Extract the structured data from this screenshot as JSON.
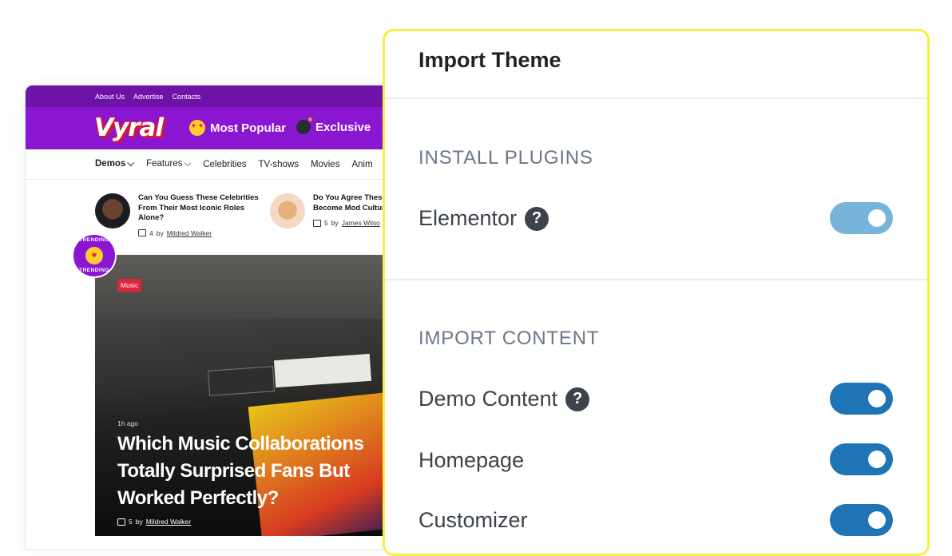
{
  "site": {
    "top_links": [
      "About Us",
      "Advertise",
      "Contacts"
    ],
    "logo": "Vyral",
    "header_links": [
      {
        "label": "Most Popular",
        "icon": "heart-eyes-emoji-icon"
      },
      {
        "label": "Exclusive",
        "icon": "bomb-icon"
      }
    ],
    "nav": {
      "demos": "Demos",
      "features": "Features",
      "celebrities": "Celebrities",
      "tvshows": "TV-shows",
      "movies": "Movies",
      "animals": "Anim"
    },
    "cards": [
      {
        "title": "Can You Guess These Celebrities From Their Most Iconic Roles Alone?",
        "comments": "4",
        "by": "by",
        "author": "Mildred Walker"
      },
      {
        "title": "Do You Agree These Have Become Mod Cultural Icons?",
        "comments": "5",
        "by": "by",
        "author": "James Wilso"
      }
    ],
    "badge": {
      "top": "TRENDING",
      "bottom": "TRENDING"
    },
    "hero": {
      "tag": "Music",
      "time": "1h ago",
      "title": "Which Music Collaborations Totally Surprised Fans But Worked Perfectly?",
      "comments": "5",
      "by": "by",
      "author": "Mildred Walker"
    }
  },
  "panel": {
    "title": "Import Theme",
    "install_plugins": {
      "heading": "INSTALL PLUGINS",
      "items": [
        {
          "label": "Elementor",
          "help": "?",
          "enabled": true
        }
      ]
    },
    "import_content": {
      "heading": "IMPORT CONTENT",
      "items": [
        {
          "label": "Demo Content",
          "help": "?",
          "enabled": true
        },
        {
          "label": "Homepage",
          "enabled": true
        },
        {
          "label": "Customizer",
          "enabled": true
        }
      ]
    },
    "colors": {
      "toggle_on": "#1f74b5",
      "toggle_light": "#78b4d9",
      "highlight_border": "#f5f23f",
      "brand_purple": "#8a16d2"
    }
  }
}
